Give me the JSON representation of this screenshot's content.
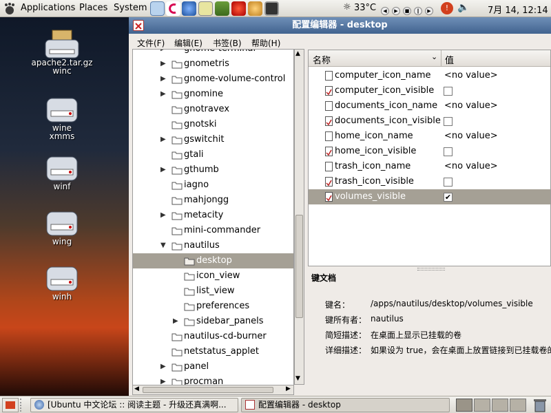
{
  "top_panel": {
    "menus": [
      "Applications",
      "Places",
      "System"
    ],
    "weather": "33°C",
    "clock": "7月 14, 12:14"
  },
  "desktop_icons": [
    "apache2.tar.gz",
    "winc",
    "wine",
    "xmms",
    "winf",
    "wing",
    "winh"
  ],
  "window": {
    "title": "配置编辑器 - desktop",
    "menu": [
      "文件(F)",
      "编辑(E)",
      "书签(B)",
      "帮助(H)"
    ]
  },
  "tree": {
    "partial_top": "gnome-terminal",
    "items": [
      {
        "label": "gnometris",
        "arrow": "right",
        "indent": 0
      },
      {
        "label": "gnome-volume-control",
        "arrow": "right",
        "indent": 0
      },
      {
        "label": "gnomine",
        "arrow": "right",
        "indent": 0
      },
      {
        "label": "gnotravex",
        "arrow": "",
        "indent": 0
      },
      {
        "label": "gnotski",
        "arrow": "",
        "indent": 0
      },
      {
        "label": "gswitchit",
        "arrow": "right",
        "indent": 0
      },
      {
        "label": "gtali",
        "arrow": "",
        "indent": 0
      },
      {
        "label": "gthumb",
        "arrow": "right",
        "indent": 0
      },
      {
        "label": "iagno",
        "arrow": "",
        "indent": 0
      },
      {
        "label": "mahjongg",
        "arrow": "",
        "indent": 0
      },
      {
        "label": "metacity",
        "arrow": "right",
        "indent": 0
      },
      {
        "label": "mini-commander",
        "arrow": "",
        "indent": 0
      },
      {
        "label": "nautilus",
        "arrow": "down",
        "indent": 0
      },
      {
        "label": "desktop",
        "arrow": "",
        "indent": 1,
        "selected": true
      },
      {
        "label": "icon_view",
        "arrow": "",
        "indent": 1
      },
      {
        "label": "list_view",
        "arrow": "",
        "indent": 1
      },
      {
        "label": "preferences",
        "arrow": "",
        "indent": 1
      },
      {
        "label": "sidebar_panels",
        "arrow": "right",
        "indent": 1
      },
      {
        "label": "nautilus-cd-burner",
        "arrow": "",
        "indent": 0
      },
      {
        "label": "netstatus_applet",
        "arrow": "",
        "indent": 0
      },
      {
        "label": "panel",
        "arrow": "right",
        "indent": 0
      },
      {
        "label": "procman",
        "arrow": "right",
        "indent": 0
      }
    ]
  },
  "list": {
    "col_name": "名称",
    "col_value": "值",
    "rows": [
      {
        "name": "computer_icon_name",
        "value": "<no value>",
        "type": "string"
      },
      {
        "name": "computer_icon_visible",
        "value": "",
        "type": "bool",
        "checked": false
      },
      {
        "name": "documents_icon_name",
        "value": "<no value>",
        "type": "string"
      },
      {
        "name": "documents_icon_visible",
        "value": "",
        "type": "bool",
        "checked": false
      },
      {
        "name": "home_icon_name",
        "value": "<no value>",
        "type": "string"
      },
      {
        "name": "home_icon_visible",
        "value": "",
        "type": "bool",
        "checked": false
      },
      {
        "name": "trash_icon_name",
        "value": "<no value>",
        "type": "string"
      },
      {
        "name": "trash_icon_visible",
        "value": "",
        "type": "bool",
        "checked": false
      },
      {
        "name": "volumes_visible",
        "value": "",
        "type": "bool",
        "checked": true,
        "selected": true
      }
    ]
  },
  "key_doc": {
    "heading": "键文档",
    "key_name_label": "键名：",
    "key_name": "/apps/nautilus/desktop/volumes_visible",
    "owner_label": "键所有者：",
    "owner": "nautilus",
    "short_label": "简短描述：",
    "short": "在桌面上显示已挂载的卷",
    "long_label": "详细描述：",
    "long": "如果设为 true，会在桌面上放置链接到已挂载卷的图标"
  },
  "taskbar": {
    "tasks": [
      "[Ubuntu 中文论坛 :: 阅读主题 - 升级还真满啊...",
      "配置编辑器 - desktop"
    ]
  }
}
